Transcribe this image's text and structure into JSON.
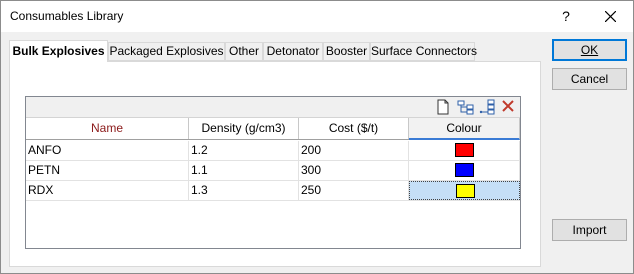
{
  "window": {
    "title": "Consumables Library",
    "help_label": "?"
  },
  "tabs": [
    {
      "label": "Bulk Explosives",
      "active": true
    },
    {
      "label": "Packaged Explosives",
      "active": false
    },
    {
      "label": "Other",
      "active": false
    },
    {
      "label": "Detonator",
      "active": false
    },
    {
      "label": "Booster",
      "active": false
    },
    {
      "label": "Surface Connectors",
      "active": false
    }
  ],
  "grid": {
    "toolbar_icons": [
      "new-document-icon",
      "insert-row-icon",
      "append-row-icon",
      "delete-icon"
    ],
    "columns": [
      "Name",
      "Density (g/cm3)",
      "Cost ($/t)",
      "Colour"
    ],
    "rows": [
      {
        "name": "ANFO",
        "density": "1.2",
        "cost": "200",
        "colour": "#ff0000"
      },
      {
        "name": "PETN",
        "density": "1.1",
        "cost": "300",
        "colour": "#0000ff"
      },
      {
        "name": "RDX",
        "density": "1.3",
        "cost": "250",
        "colour": "#ffff00"
      }
    ],
    "selected_row": 2
  },
  "buttons": {
    "ok": "OK",
    "cancel": "Cancel",
    "import": "Import"
  },
  "colors": {
    "name_header": "#8b1a1a",
    "delete_icon": "#c0392b",
    "selection": "#c5dff7"
  }
}
